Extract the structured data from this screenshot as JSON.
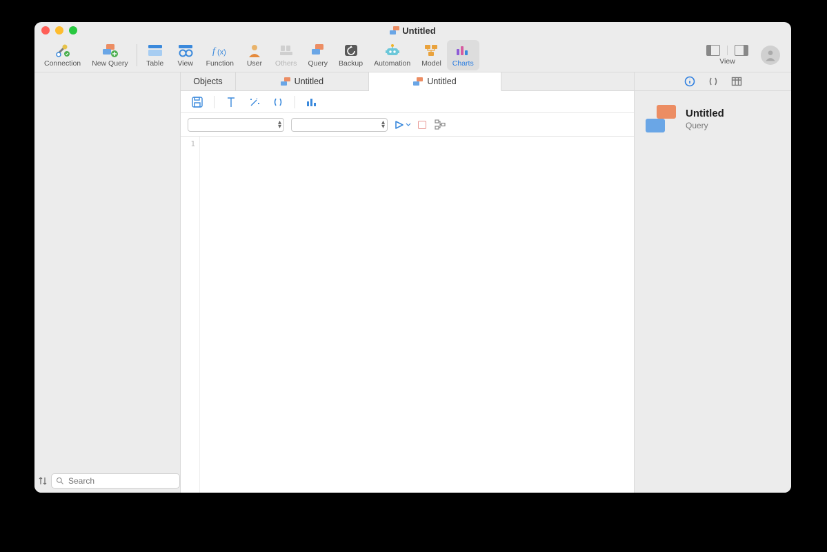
{
  "window": {
    "title": "Untitled"
  },
  "toolbar": {
    "connection": "Connection",
    "newQuery": "New Query",
    "table": "Table",
    "view": "View",
    "function": "Function",
    "user": "User",
    "others": "Others",
    "query": "Query",
    "backup": "Backup",
    "automation": "Automation",
    "model": "Model",
    "charts": "Charts",
    "viewGroup": "View"
  },
  "tabs": {
    "objects": "Objects",
    "untitled1": "Untitled",
    "untitled2": "Untitled"
  },
  "editor": {
    "lineNumber": "1"
  },
  "search": {
    "placeholder": "Search"
  },
  "rightPanel": {
    "title": "Untitled",
    "subtitle": "Query"
  }
}
